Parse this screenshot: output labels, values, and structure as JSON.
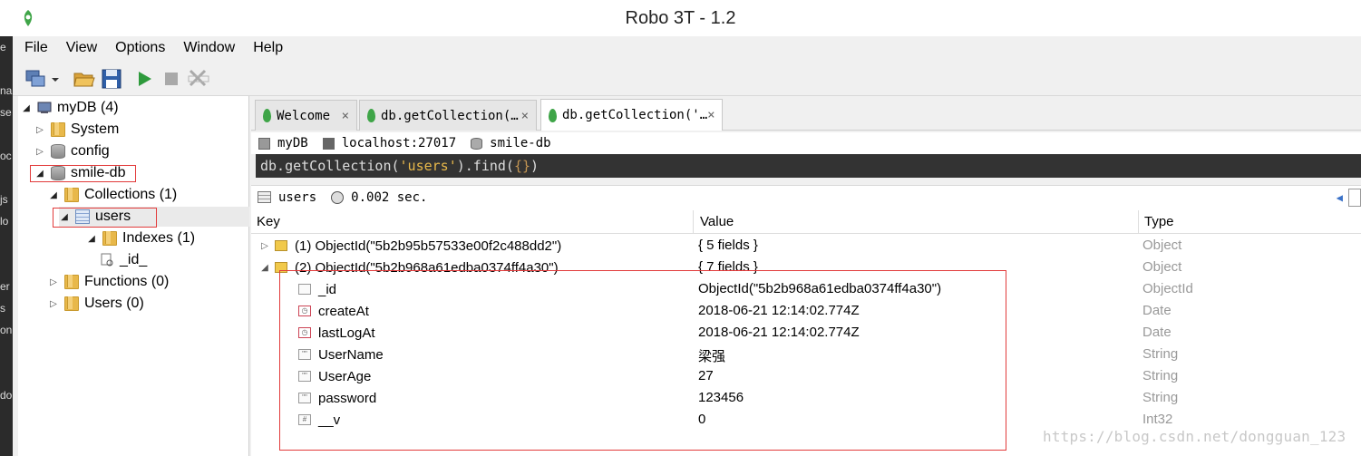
{
  "window": {
    "title": "Robo 3T - 1.2"
  },
  "menu": [
    "File",
    "View",
    "Options",
    "Window",
    "Help"
  ],
  "toolbar": {
    "buttons": [
      "connect-icon",
      "dropdown-icon",
      "open-folder-icon",
      "save-icon",
      "play-icon",
      "stop-icon",
      "format-icon"
    ]
  },
  "explorer": {
    "root": "myDB (4)",
    "items": {
      "system": "System",
      "config": "config",
      "smile_db": "smile-db",
      "collections": "Collections (1)",
      "users": "users",
      "indexes": "Indexes (1)",
      "index_id": "_id_",
      "functions": "Functions (0)",
      "db_users": "Users (0)"
    }
  },
  "tabs": [
    {
      "label": "Welcome",
      "close": "×"
    },
    {
      "label": "db.getCollection(…",
      "close": "×"
    },
    {
      "label": "db.getCollection('…",
      "close": "×"
    }
  ],
  "info": {
    "db_label": "myDB",
    "host": "localhost:27017",
    "database": "smile-db"
  },
  "query": {
    "prefix": "db.getCollection(",
    "arg": "'users'",
    "mid": ").find(",
    "braces": "{}",
    "suffix": ")"
  },
  "result": {
    "collection": "users",
    "time": "0.002 sec."
  },
  "grid": {
    "headers": {
      "key": "Key",
      "value": "Value",
      "type": "Type"
    },
    "rows": [
      {
        "key": "(1) ObjectId(\"5b2b95b57533e00f2c488dd2\")",
        "value": "{ 5 fields }",
        "type": "Object",
        "expanded": false
      },
      {
        "key": "(2) ObjectId(\"5b2b968a61edba0374ff4a30\")",
        "value": "{ 7 fields }",
        "type": "Object",
        "expanded": true
      }
    ],
    "fields": [
      {
        "key": "_id",
        "value": "ObjectId(\"5b2b968a61edba0374ff4a30\")",
        "type": "ObjectId",
        "icon": "id-icon"
      },
      {
        "key": "createAt",
        "value": "2018-06-21 12:14:02.774Z",
        "type": "Date",
        "icon": "date-icon"
      },
      {
        "key": "lastLogAt",
        "value": "2018-06-21 12:14:02.774Z",
        "type": "Date",
        "icon": "date-icon"
      },
      {
        "key": "UserName",
        "value": "梁强",
        "type": "String",
        "icon": "string-icon"
      },
      {
        "key": "UserAge",
        "value": "27",
        "type": "String",
        "icon": "string-icon"
      },
      {
        "key": "password",
        "value": "123456",
        "type": "String",
        "icon": "string-icon"
      },
      {
        "key": "__v",
        "value": "0",
        "type": "Int32",
        "icon": "int-icon"
      }
    ]
  },
  "watermark": "https://blog.csdn.net/dongguan_123",
  "background_window_text": [
    "e",
    "",
    "na",
    "se",
    "",
    "oc",
    "",
    "js",
    "lo",
    "",
    "",
    "er",
    "s",
    "on",
    "",
    "",
    "do"
  ],
  "colors": {
    "highlight_box": "#e23b3b",
    "query_bg": "#333333",
    "query_string": "#e8b84a",
    "leaf_green": "#3fa548"
  }
}
